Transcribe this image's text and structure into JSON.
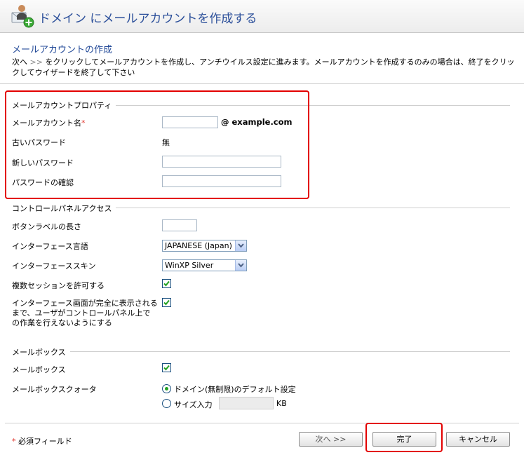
{
  "header": {
    "title": "ドメイン にメールアカウントを作成する",
    "icon": "mail-account-add-icon"
  },
  "section_title": "メールアカウントの作成",
  "intro": {
    "prefix": "次へ",
    "next_marker": ">>",
    "text": "をクリックしてメールアカウントを作成し、アンチウイルス設定に進みます。メールアカウントを作成するのみの場合は、終了をクリックしてウイザードを終了して下さい"
  },
  "account_properties": {
    "legend": "メールアカウントプロパティ",
    "account_name_label": "メールアカウント名",
    "required_mark": "*",
    "account_name_value": "",
    "domain_suffix": "@ example.com",
    "old_password_label": "古いパスワード",
    "old_password_value": "無",
    "new_password_label": "新しいパスワード",
    "confirm_password_label": "パスワードの確認"
  },
  "control_panel": {
    "legend": "コントロールパネルアクセス",
    "button_label_length_label": "ボタンラベルの長さ",
    "button_label_length_value": "",
    "language_label": "インターフェース言語",
    "language_value": "JAPANESE (Japan)",
    "skin_label": "インターフェーススキン",
    "skin_value": "WinXP Silver",
    "multi_session_label": "複数セッションを許可する",
    "multi_session_checked": true,
    "block_until_loaded_label": "インターフェース画面が完全に表示されるまで、ユーザがコントロールパネル上での作業を行えないようにする",
    "block_until_loaded_checked": true
  },
  "mailbox": {
    "legend": "メールボックス",
    "mailbox_label": "メールボックス",
    "mailbox_checked": true,
    "quota_label": "メールボックスクォータ",
    "quota_default_label": "ドメイン(無制限)のデフォルト設定",
    "quota_default_selected": true,
    "quota_size_label": "サイズ入力",
    "quota_size_value": "",
    "quota_unit": "KB"
  },
  "footer": {
    "required_mark": "*",
    "required_note": "必須フィールド",
    "next_button": "次へ >>",
    "finish_button": "完了",
    "cancel_button": "キャンセル"
  },
  "colors": {
    "title_blue": "#2b4f9a",
    "highlight_red": "#e30000",
    "required_red": "#e0342c",
    "check_green": "#21a121"
  }
}
